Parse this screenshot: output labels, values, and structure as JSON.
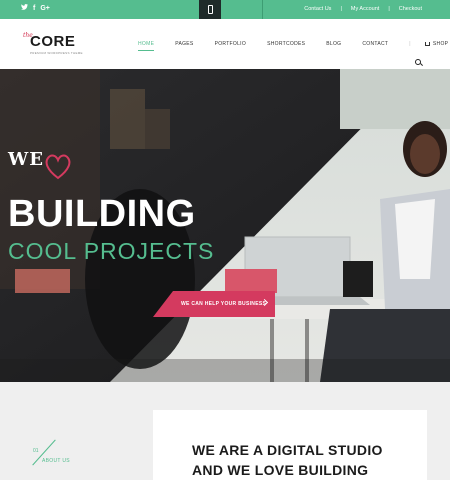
{
  "topbar": {
    "social": [
      "twitter-icon",
      "facebook-icon",
      "google-plus-icon"
    ],
    "social_glyphs": [
      "🐦",
      "f",
      "G+"
    ],
    "links": [
      {
        "label": "Contact Us"
      },
      {
        "label": "My Account"
      },
      {
        "label": "Checkout"
      }
    ],
    "accent": "#55bd8f"
  },
  "header": {
    "logo": {
      "prefix": "the",
      "name": "CORE",
      "tagline": "PREMIUM WORDPRESS THEME"
    },
    "nav": [
      {
        "label": "HOME",
        "active": true
      },
      {
        "label": "PAGES"
      },
      {
        "label": "PORTFOLIO"
      },
      {
        "label": "SHORTCODES"
      },
      {
        "label": "BLOG"
      },
      {
        "label": "CONTACT"
      }
    ],
    "shop_label": "SHOP"
  },
  "hero": {
    "we": "WE",
    "building": "BUILDING",
    "cool": "COOL PROJECTS",
    "cta": "WE CAN HELP YOUR BUSINESS",
    "cta_color": "#d43a5f"
  },
  "about": {
    "number": "01",
    "label": "ABOUT US",
    "heading_line1": "WE ARE A DIGITAL STUDIO",
    "heading_line2": "AND WE LOVE BUILDING"
  }
}
